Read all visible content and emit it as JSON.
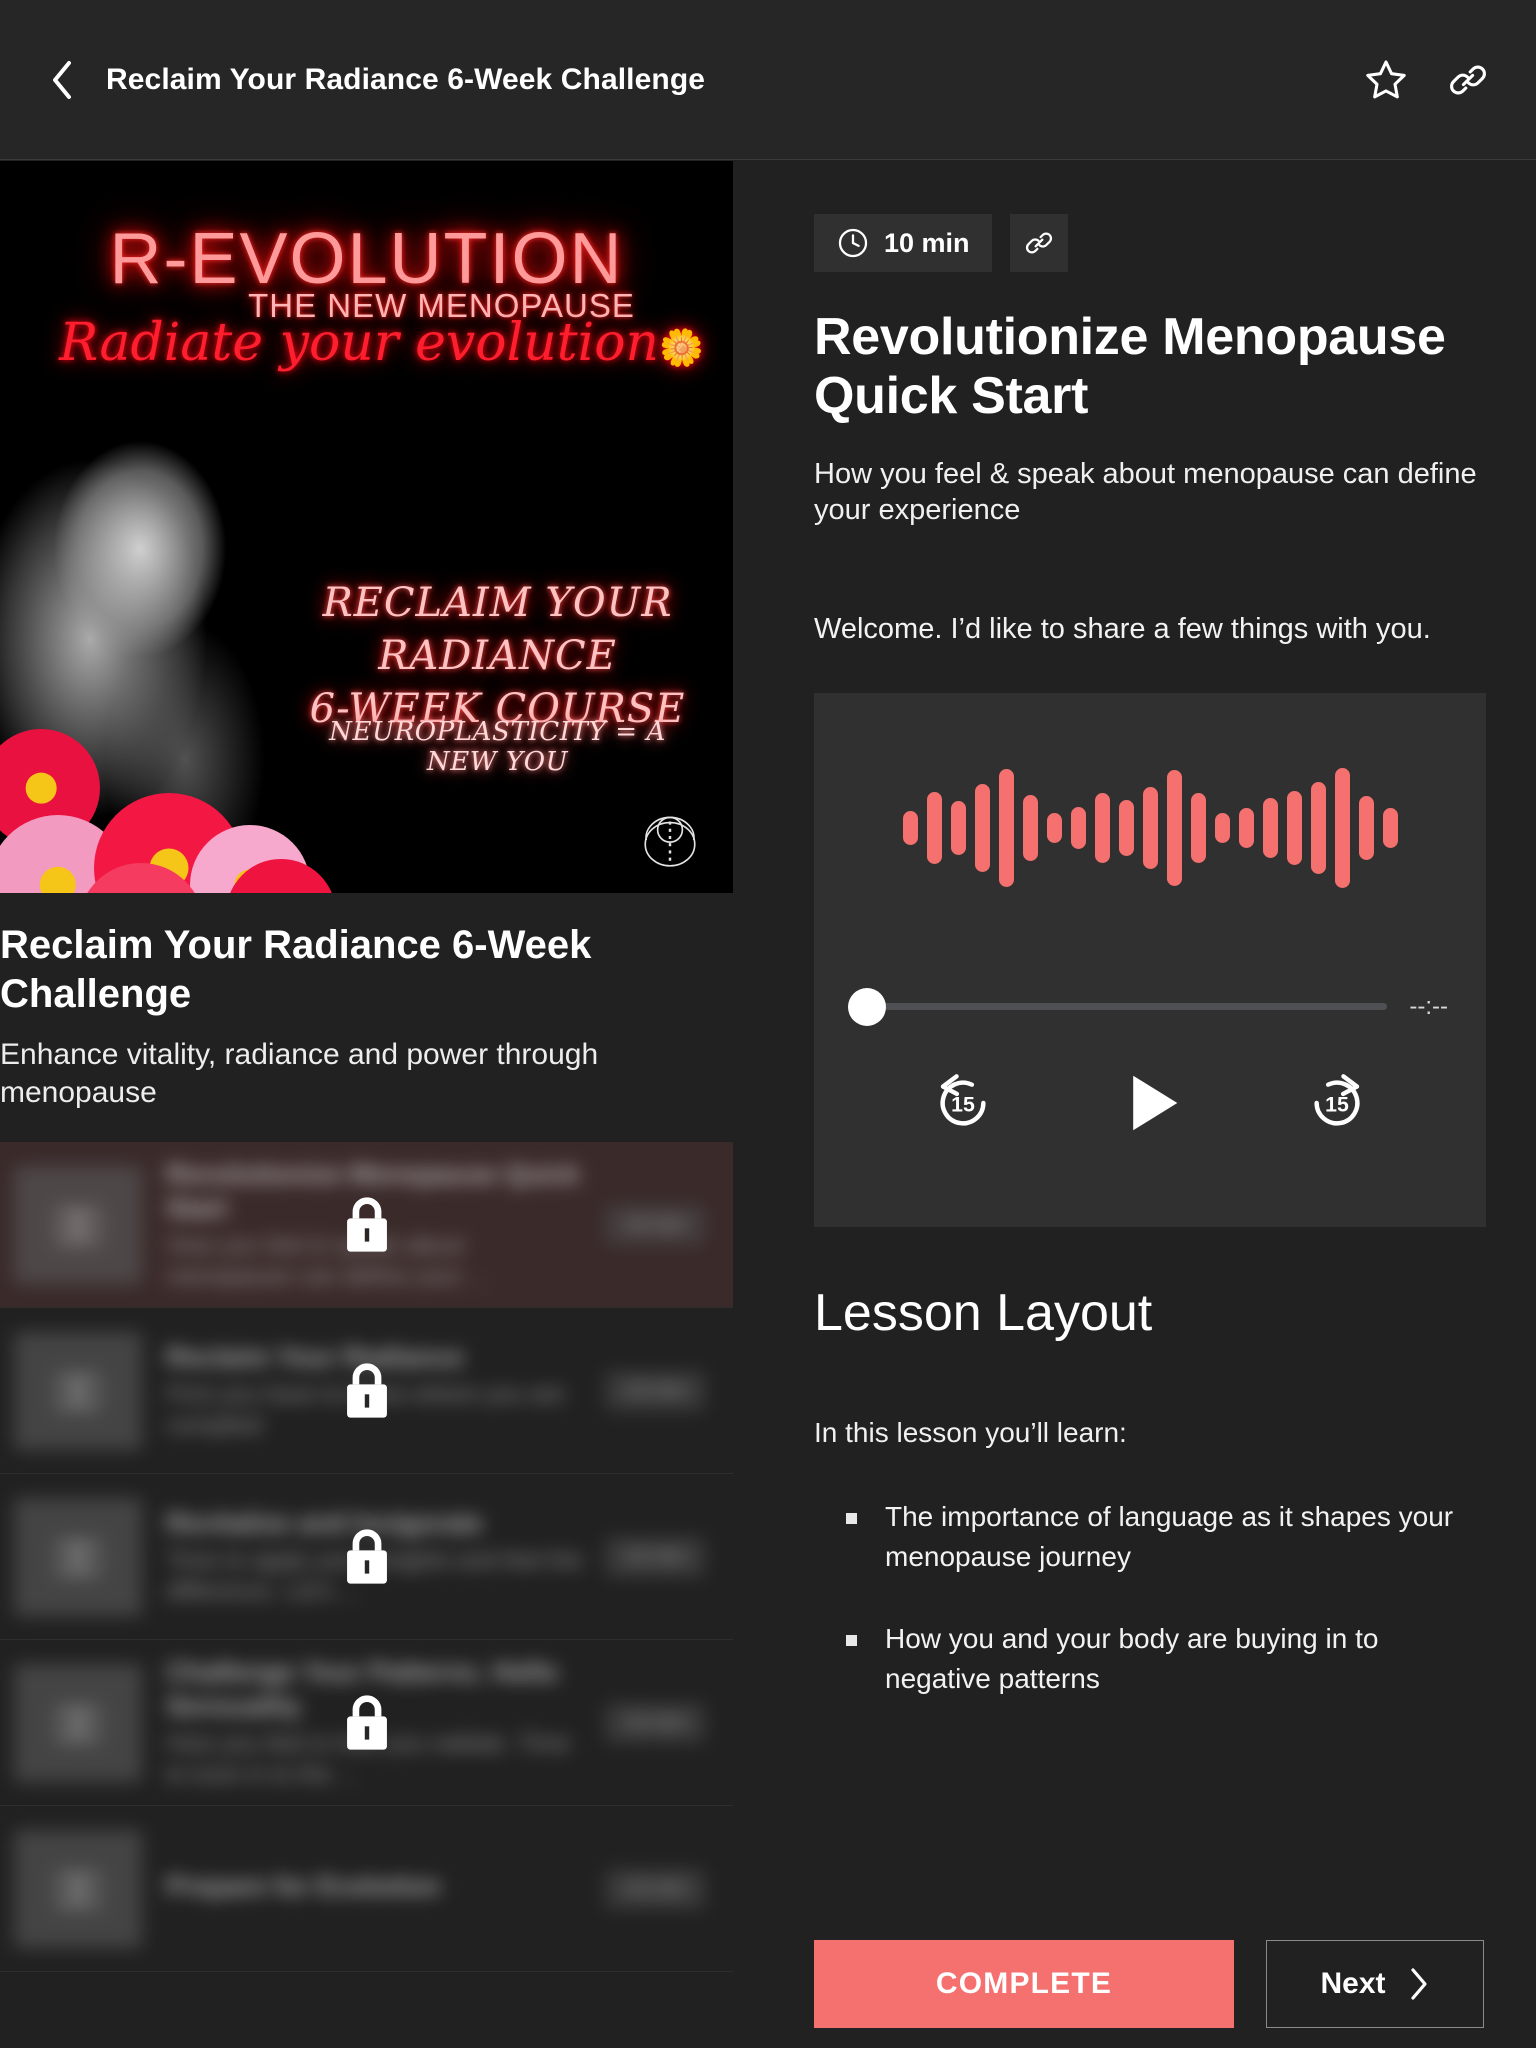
{
  "header": {
    "title": "Reclaim Your Radiance 6-Week Challenge",
    "back_icon": "chevron-left-icon",
    "favorite_icon": "star-icon",
    "share_icon": "link-icon"
  },
  "course": {
    "cover": {
      "neon_title": "R-EVOLUTION",
      "neon_subtitle": "THE NEW MENOPAUSE",
      "neon_script": "Radiate your evolution",
      "neon_course_line1": "RECLAIM YOUR RADIANCE",
      "neon_course_line2": "6-WEEK COURSE",
      "neon_tagline": "NEUROPLASTICITY = A NEW YOU"
    },
    "title": "Reclaim Your Radiance 6-Week Challenge",
    "subtitle": "Enhance vitality, radiance and power through menopause"
  },
  "lessons": [
    {
      "name": "Revolutionize Menopause Quick Start",
      "description": "How you feel & speak about menopause can define your ...",
      "duration": "10 min",
      "locked": true,
      "active": true,
      "icon": "book-icon",
      "lock_icon": "lock-icon"
    },
    {
      "name": "Reclaim Your Radiance",
      "description": "First you have to know where you are complied",
      "duration": "10 min",
      "locked": true,
      "active": false,
      "icon": "book-icon",
      "lock_icon": "lock-icon"
    },
    {
      "name": "Revitalize and Invigorate",
      "description": "Time to apply your insights and feel the difference. Let's ...",
      "duration": "10 min",
      "locked": true,
      "active": false,
      "icon": "book-icon",
      "lock_icon": "lock-icon"
    },
    {
      "name": "Challenge Your Patterns. Hello Sensuality",
      "description": "How you feel is how you radiate. Time to tune in to the ...",
      "duration": "10 min",
      "locked": true,
      "active": false,
      "icon": "book-icon",
      "lock_icon": "lock-icon"
    },
    {
      "name": "Prepare for Evolution",
      "description": "",
      "duration": "10 min",
      "locked": true,
      "active": false,
      "icon": "book-icon",
      "lock_icon": "lock-icon"
    }
  ],
  "lesson": {
    "duration": "10 min",
    "duration_icon": "clock-icon",
    "share_icon": "link-icon",
    "title": "Revolutionize Menopause Quick Start",
    "summary": "How you feel & speak about menopause can define your experience",
    "welcome": "Welcome. I’d like to share a few things with you."
  },
  "player": {
    "time_display": "--:--",
    "progress_percent": 0,
    "rewind_label": "15",
    "forward_label": "15",
    "rewind_icon": "replay-15-icon",
    "play_icon": "play-icon",
    "forward_icon": "forward-15-icon",
    "waveform_color": "#f4716f",
    "waveform": [
      34,
      72,
      54,
      88,
      118,
      66,
      30,
      42,
      70,
      56,
      82,
      116,
      70,
      30,
      40,
      60,
      74,
      92,
      120,
      64,
      40
    ]
  },
  "content": {
    "section_heading": "Lesson Layout",
    "lead": "In this lesson you’ll learn:",
    "bullets": [
      "The importance of language as it shapes your menopause journey",
      "How you and your body are buying in to negative patterns"
    ]
  },
  "actions": {
    "complete_label": "COMPLETE",
    "next_label": "Next",
    "next_icon": "chevron-right-icon",
    "complete_color": "#f4716f"
  }
}
